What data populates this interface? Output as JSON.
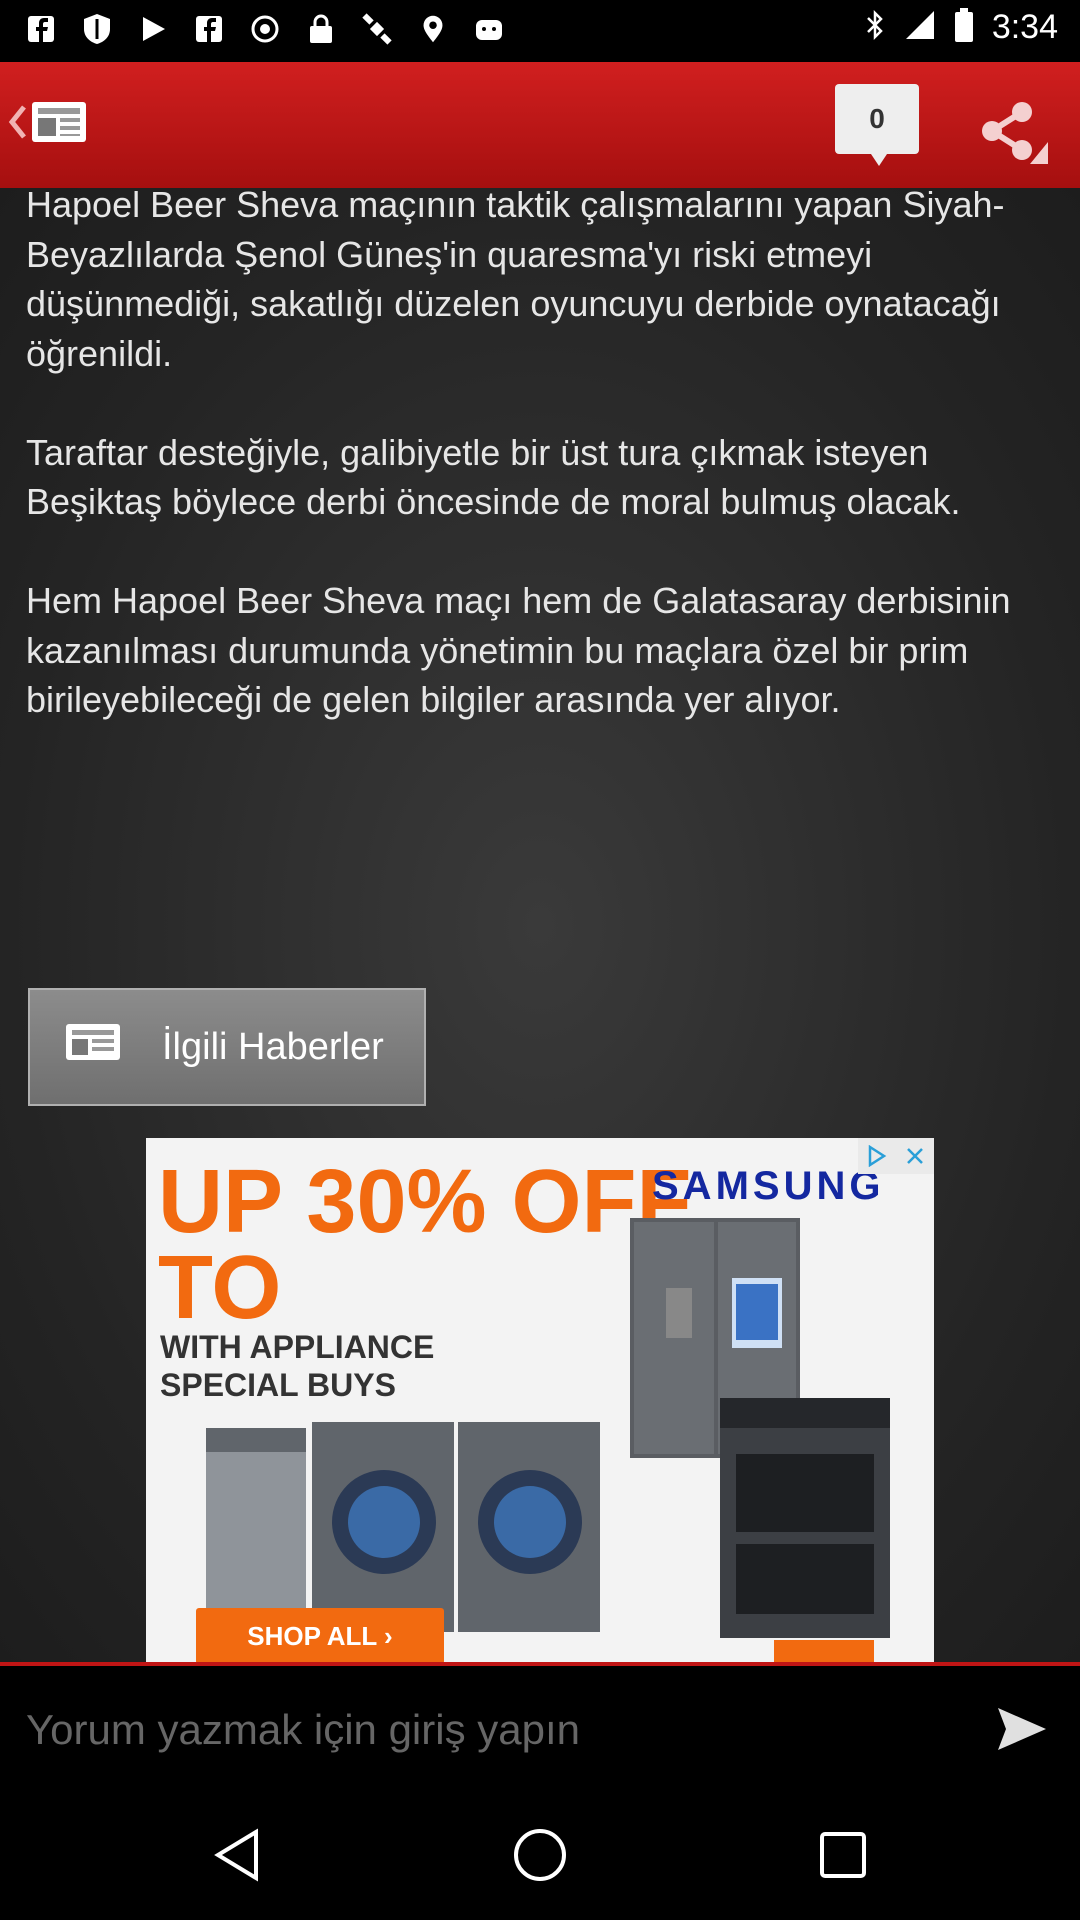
{
  "status_bar": {
    "time": "3:34",
    "icons": [
      "facebook-icon",
      "shield-icon",
      "play-store-icon",
      "facebook-icon",
      "alarm-icon",
      "lock-icon",
      "satellite-icon",
      "fake-gps-icon",
      "android-icon",
      "bluetooth-icon",
      "signal-icon",
      "battery-icon"
    ]
  },
  "header": {
    "back_icon": "newspaper-icon",
    "comment_count": "0",
    "share_icon": "share-icon",
    "accent_color": "#c01515"
  },
  "article": {
    "paragraphs": [
      "Hapoel Beer Sheva maçının taktik çalışmalarını yapan Siyah-Beyazlılarda Şenol Güneş'in quaresma'yı riski etmeyi düşünmediği, sakatlığı düzelen oyuncuyu derbide oynatacağı öğrenildi.",
      "Taraftar desteğiyle, galibiyetle bir üst tura çıkmak isteyen Beşiktaş böylece derbi öncesinde de moral bulmuş olacak.",
      "Hem Hapoel Beer Sheva maçı hem de Galatasaray derbisinin kazanılması durumunda yönetimin bu maçlara özel bir prim birileyebileceği de gelen bilgiler arasında yer alıyor."
    ]
  },
  "related": {
    "label": "İlgili Haberler"
  },
  "ad": {
    "brand": "SAMSUNG",
    "headline_line1": "UP 30% OFF",
    "headline_line2": "TO",
    "subtext_line1": "WITH APPLIANCE",
    "subtext_line2": "SPECIAL BUYS",
    "cta": "SHOP ALL ›",
    "accent_color": "#f26a10"
  },
  "comment": {
    "placeholder": "Yorum yazmak için giriş yapın"
  }
}
